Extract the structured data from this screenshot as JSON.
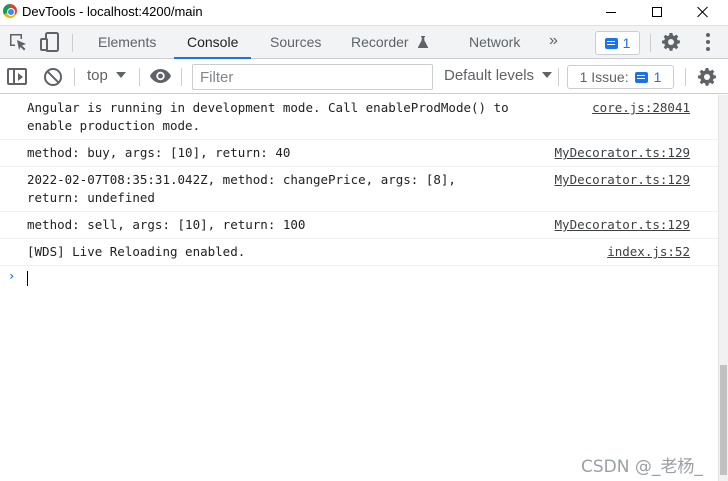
{
  "window": {
    "title": "DevTools - localhost:4200/main"
  },
  "tabs": [
    {
      "label": "Elements"
    },
    {
      "label": "Console",
      "active": true
    },
    {
      "label": "Sources"
    },
    {
      "label": "Recorder"
    },
    {
      "label": "Network"
    }
  ],
  "header": {
    "more_tabs_glyph": "»",
    "message_count": "1"
  },
  "toolbar": {
    "context": "top",
    "filter_placeholder": "Filter",
    "levels": "Default levels",
    "issue_label": "1 Issue:",
    "issue_count": "1"
  },
  "console_messages": [
    {
      "text": "Angular is running in development mode. Call enableProdMode() to enable production mode.",
      "source": "core.js:28041"
    },
    {
      "text": "method: buy, args: [10], return: 40",
      "source": "MyDecorator.ts:129"
    },
    {
      "text": "2022-02-07T08:35:31.042Z, method: changePrice, args: [8],\nreturn: undefined",
      "source": "MyDecorator.ts:129"
    },
    {
      "text": "method: sell, args: [10], return: 100",
      "source": "MyDecorator.ts:129"
    },
    {
      "text": "[WDS] Live Reloading enabled.",
      "source": "index.js:52"
    }
  ],
  "prompt_glyph": "›",
  "watermark": "CSDN @_老杨_",
  "colors": {
    "accent": "#1a73e8",
    "tab_bar_bg": "#f1f3f4",
    "border": "#cbcdd1"
  },
  "icons": [
    "inspect-icon",
    "device-toolbar-icon",
    "flask-icon",
    "chat-icon",
    "gear-icon",
    "kebab-menu-icon",
    "sidebar-toggle-icon",
    "clear-console-icon",
    "eye-icon"
  ]
}
